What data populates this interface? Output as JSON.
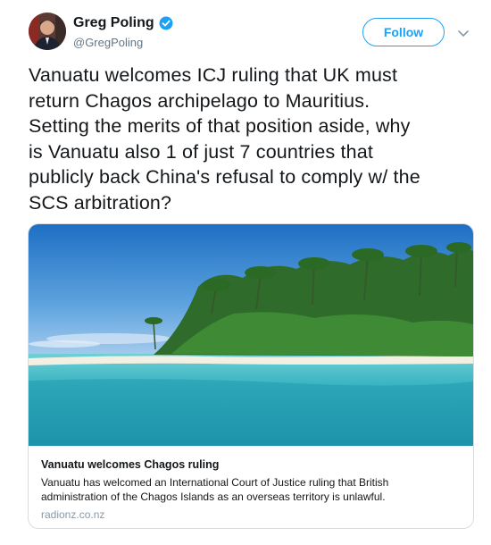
{
  "author": {
    "name": "Greg Poling",
    "handle": "@GregPoling",
    "verified_icon": "verified-badge-icon",
    "avatar_icon": "avatar"
  },
  "follow_label": "Follow",
  "caret_icon": "chevron-down-icon",
  "tweet_lines": [
    "Vanuatu welcomes ICJ ruling that UK must",
    "return Chagos archipelago to Mauritius.",
    "Setting the merits of that position aside, why",
    "is Vanuatu also 1 of just 7 countries that",
    "publicly back China's refusal to comply w/ the",
    "SCS arbitration?"
  ],
  "card": {
    "image_icon": "tropical-island-photo",
    "title": "Vanuatu welcomes Chagos ruling",
    "description_lines": [
      "Vanuatu has welcomed an International Court of Justice ruling that British",
      "administration of the Chagos Islands as an overseas territory is unlawful."
    ],
    "domain": "radionz.co.nz"
  },
  "colors": {
    "accent": "#1da1f2",
    "text": "#14171a",
    "muted": "#657786"
  }
}
